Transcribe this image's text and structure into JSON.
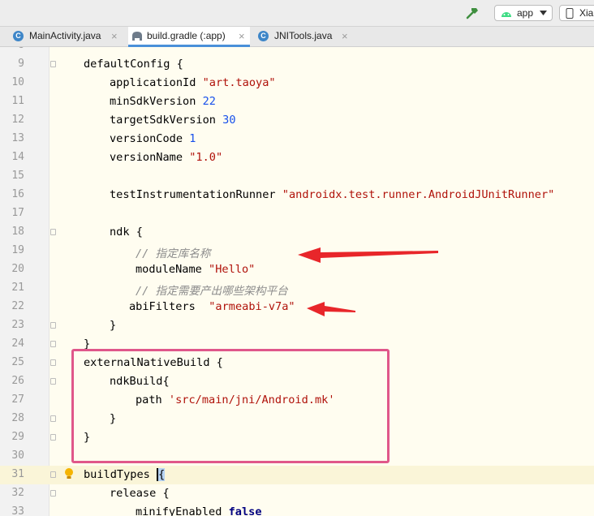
{
  "toolbar": {
    "run_config": "app",
    "device": "Xia"
  },
  "tabs": [
    {
      "label": "MainActivity.java",
      "icon": "java-class-icon",
      "close": "×"
    },
    {
      "label": "build.gradle (:app)",
      "icon": "gradle-elephant-icon",
      "close": "×"
    },
    {
      "label": "JNITools.java",
      "icon": "java-class-icon",
      "close": "×"
    }
  ],
  "code": {
    "line9": {
      "n": "9",
      "t": "defaultConfig {"
    },
    "line10": {
      "n": "10",
      "k": "applicationId ",
      "s": "\"art.taoya\""
    },
    "line11": {
      "n": "11",
      "k": "minSdkVersion ",
      "v": "22"
    },
    "line12": {
      "n": "12",
      "k": "targetSdkVersion ",
      "v": "30"
    },
    "line13": {
      "n": "13",
      "k": "versionCode ",
      "v": "1"
    },
    "line14": {
      "n": "14",
      "k": "versionName ",
      "s": "\"1.0\""
    },
    "line15": {
      "n": "15"
    },
    "line16": {
      "n": "16",
      "k": "testInstrumentationRunner ",
      "s": "\"androidx.test.runner.AndroidJUnitRunner\""
    },
    "line17": {
      "n": "17"
    },
    "line18": {
      "n": "18",
      "t": "ndk {"
    },
    "line19": {
      "n": "19",
      "c": "// 指定库名称"
    },
    "line20": {
      "n": "20",
      "k": "moduleName ",
      "s": "\"Hello\""
    },
    "line21": {
      "n": "21",
      "c": "// 指定需要产出哪些架构平台"
    },
    "line22": {
      "n": "22",
      "k": "abiFilters  ",
      "s": "\"armeabi-v7a\""
    },
    "line23": {
      "n": "23",
      "t": "}"
    },
    "line24": {
      "n": "24",
      "t": "}"
    },
    "line25": {
      "n": "25",
      "t": "externalNativeBuild {"
    },
    "line26": {
      "n": "26",
      "t": "ndkBuild{"
    },
    "line27": {
      "n": "27",
      "k": "path ",
      "s": "'src/main/jni/Android.mk'"
    },
    "line28": {
      "n": "28",
      "t": "}"
    },
    "line29": {
      "n": "29",
      "t": "}"
    },
    "line30": {
      "n": "30"
    },
    "line31": {
      "n": "31",
      "t": "buildTypes ",
      "b": "{"
    },
    "line32": {
      "n": "32",
      "t": "release {"
    },
    "line33": {
      "n": "33",
      "k": "minifyEnabled ",
      "w": "false"
    }
  },
  "colors": {
    "highlight_box": "#E0578A",
    "arrow": "#E8262A",
    "string": "#B0120A",
    "number": "#1750EB",
    "comment": "#8C8C8C"
  }
}
